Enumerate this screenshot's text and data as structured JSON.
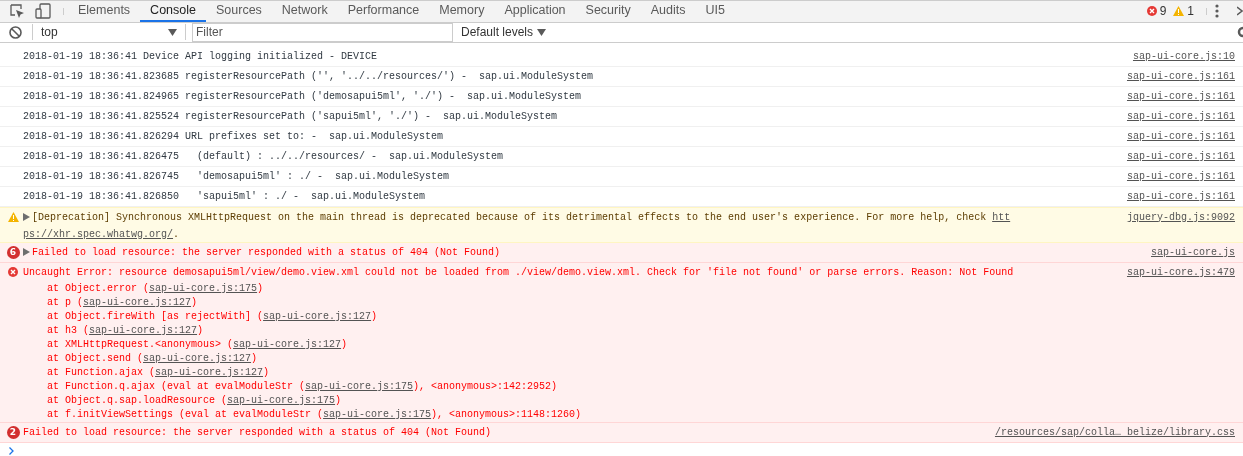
{
  "tabs": [
    {
      "label": "Elements",
      "selected": false
    },
    {
      "label": "Console",
      "selected": true
    },
    {
      "label": "Sources",
      "selected": false
    },
    {
      "label": "Network",
      "selected": false
    },
    {
      "label": "Performance",
      "selected": false
    },
    {
      "label": "Memory",
      "selected": false
    },
    {
      "label": "Application",
      "selected": false
    },
    {
      "label": "Security",
      "selected": false
    },
    {
      "label": "Audits",
      "selected": false
    },
    {
      "label": "UI5",
      "selected": false
    }
  ],
  "counters": {
    "errors": "9",
    "warnings": "1"
  },
  "toolbar": {
    "context": "top",
    "filter": {
      "placeholder": "Filter"
    },
    "levels": "Default levels"
  },
  "messages": [
    {
      "kind": "log",
      "lines": [
        [
          {
            "kind": "text",
            "text": "2018-01-19 18:36:41 Device API logging initialized - DEVICE"
          }
        ]
      ],
      "source": "sap-ui-core.js:10"
    },
    {
      "kind": "log",
      "lines": [
        [
          {
            "kind": "text",
            "text": "2018-01-19 18:36:41.823685 registerResourcePath ('', '../../resources/') -  sap.ui.ModuleSystem"
          }
        ]
      ],
      "source": "sap-ui-core.js:161"
    },
    {
      "kind": "log",
      "lines": [
        [
          {
            "kind": "text",
            "text": "2018-01-19 18:36:41.824965 registerResourcePath ('demosapui5ml', './') -  sap.ui.ModuleSystem"
          }
        ]
      ],
      "source": "sap-ui-core.js:161"
    },
    {
      "kind": "log",
      "lines": [
        [
          {
            "kind": "text",
            "text": "2018-01-19 18:36:41.825524 registerResourcePath ('sapui5ml', './') -  sap.ui.ModuleSystem"
          }
        ]
      ],
      "source": "sap-ui-core.js:161"
    },
    {
      "kind": "log",
      "lines": [
        [
          {
            "kind": "text",
            "text": "2018-01-19 18:36:41.826294 URL prefixes set to: -  sap.ui.ModuleSystem"
          }
        ]
      ],
      "source": "sap-ui-core.js:161"
    },
    {
      "kind": "log",
      "lines": [
        [
          {
            "kind": "text",
            "text": "2018-01-19 18:36:41.826475   (default) : ../../resources/ -  sap.ui.ModuleSystem"
          }
        ]
      ],
      "source": "sap-ui-core.js:161"
    },
    {
      "kind": "log",
      "lines": [
        [
          {
            "kind": "text",
            "text": "2018-01-19 18:36:41.826745   'demosapui5ml' : ./ -  sap.ui.ModuleSystem"
          }
        ]
      ],
      "source": "sap-ui-core.js:161"
    },
    {
      "kind": "log",
      "lines": [
        [
          {
            "kind": "text",
            "text": "2018-01-19 18:36:41.826850   'sapui5ml' : ./ -  sap.ui.ModuleSystem"
          }
        ]
      ],
      "source": "sap-ui-core.js:161"
    },
    {
      "kind": "warning",
      "expanded": false,
      "lines": [
        [
          {
            "kind": "text",
            "text": "[Deprecation] Synchronous XMLHttpRequest on the main thread is deprecated because of its detrimental effects to the end user's experience. For more help, check "
          },
          {
            "kind": "link",
            "text": "htt"
          }
        ],
        [
          {
            "kind": "link",
            "text": "ps://xhr.spec.whatwg.org/"
          },
          {
            "kind": "text",
            "text": "."
          }
        ]
      ],
      "source": "jquery-dbg.js:9092"
    },
    {
      "kind": "error",
      "count": "6",
      "expanded": false,
      "lines": [
        [
          {
            "kind": "text",
            "text": "Failed to load resource: the server responded with a status of 404 (Not Found)"
          }
        ]
      ],
      "source": "sap-ui-core.js"
    },
    {
      "kind": "error",
      "lines": [
        [
          {
            "kind": "text",
            "text": "Uncaught Error: resource demosapui5ml/view/demo.view.xml could not be loaded from ./view/demo.view.xml. Check for 'file not found' or parse errors. Reason: Not Found"
          }
        ]
      ],
      "stack": [
        [
          {
            "kind": "text",
            "text": "at Object.error ("
          },
          {
            "kind": "link",
            "text": "sap-ui-core.js:175"
          },
          {
            "kind": "text",
            "text": ")"
          }
        ],
        [
          {
            "kind": "text",
            "text": "at p ("
          },
          {
            "kind": "link",
            "text": "sap-ui-core.js:127"
          },
          {
            "kind": "text",
            "text": ")"
          }
        ],
        [
          {
            "kind": "text",
            "text": "at Object.fireWith [as rejectWith] ("
          },
          {
            "kind": "link",
            "text": "sap-ui-core.js:127"
          },
          {
            "kind": "text",
            "text": ")"
          }
        ],
        [
          {
            "kind": "text",
            "text": "at h3 ("
          },
          {
            "kind": "link",
            "text": "sap-ui-core.js:127"
          },
          {
            "kind": "text",
            "text": ")"
          }
        ],
        [
          {
            "kind": "text",
            "text": "at XMLHttpRequest.<anonymous> ("
          },
          {
            "kind": "link",
            "text": "sap-ui-core.js:127"
          },
          {
            "kind": "text",
            "text": ")"
          }
        ],
        [
          {
            "kind": "text",
            "text": "at Object.send ("
          },
          {
            "kind": "link",
            "text": "sap-ui-core.js:127"
          },
          {
            "kind": "text",
            "text": ")"
          }
        ],
        [
          {
            "kind": "text",
            "text": "at Function.ajax ("
          },
          {
            "kind": "link",
            "text": "sap-ui-core.js:127"
          },
          {
            "kind": "text",
            "text": ")"
          }
        ],
        [
          {
            "kind": "text",
            "text": "at Function.q.ajax (eval at evalModuleStr ("
          },
          {
            "kind": "link",
            "text": "sap-ui-core.js:175"
          },
          {
            "kind": "text",
            "text": "), <anonymous>:142:2952)"
          }
        ],
        [
          {
            "kind": "text",
            "text": "at Object.q.sap.loadResource ("
          },
          {
            "kind": "link",
            "text": "sap-ui-core.js:175"
          },
          {
            "kind": "text",
            "text": ")"
          }
        ],
        [
          {
            "kind": "text",
            "text": "at f.initViewSettings (eval at evalModuleStr ("
          },
          {
            "kind": "link",
            "text": "sap-ui-core.js:175"
          },
          {
            "kind": "text",
            "text": "), <anonymous>:1148:1260)"
          }
        ]
      ],
      "source": "sap-ui-core.js:479"
    },
    {
      "kind": "error",
      "count": "2",
      "lines": [
        [
          {
            "kind": "text",
            "text": "Failed to load resource: the server responded with a status of 404 (Not Found)"
          }
        ]
      ],
      "source": "/resources/sap/colla… belize/library.css"
    }
  ]
}
